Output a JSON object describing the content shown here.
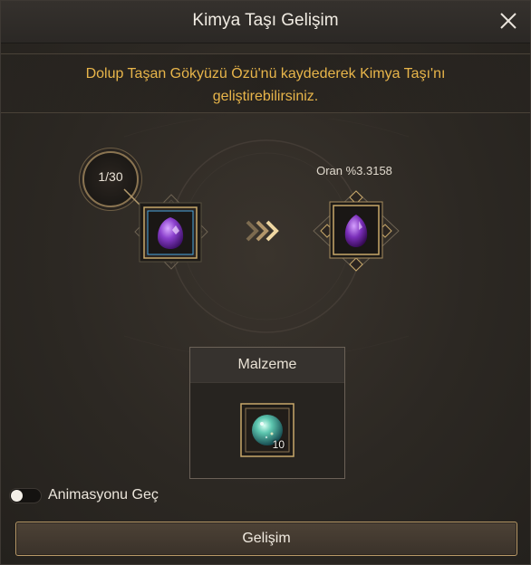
{
  "window": {
    "title": "Kimya Taşı Gelişim"
  },
  "notice": {
    "line1": "Dolup Taşan Gökyüzü Özü'nü kaydederek Kimya Taşı'nı",
    "line2": "geliştirebilirsiniz."
  },
  "upgrade": {
    "level": "1/30",
    "rate_label": "Oran %3.3158",
    "current_item_icon": "purple-gem-icon",
    "result_item_icon": "purple-gem-icon"
  },
  "materials": {
    "header": "Malzeme",
    "items": [
      {
        "icon": "green-sky-orb-icon",
        "count": "10"
      }
    ]
  },
  "skip_animation": {
    "label": "Animasyonu Geç",
    "enabled": false
  },
  "action": {
    "label": "Gelişim"
  },
  "colors": {
    "accent_gold": "#e8b54a",
    "frame_gold": "#c8a86a",
    "gem_purple": "#7a2fb0"
  }
}
